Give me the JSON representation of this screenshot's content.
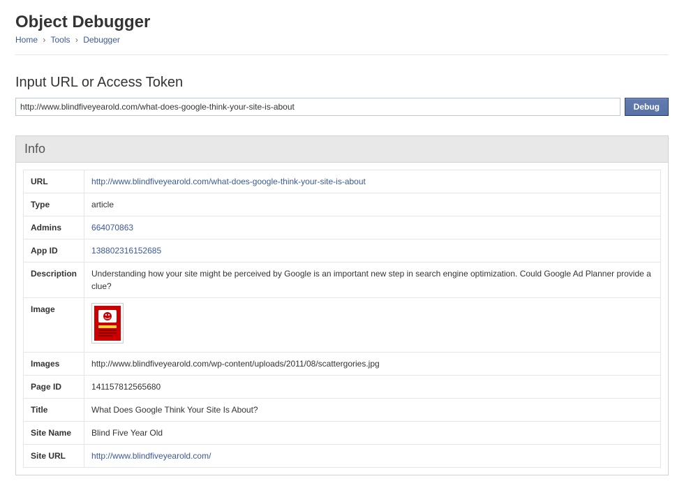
{
  "header": {
    "title": "Object Debugger"
  },
  "breadcrumb": {
    "home": "Home",
    "tools": "Tools",
    "debugger": "Debugger"
  },
  "section": {
    "input_title": "Input URL or Access Token"
  },
  "input": {
    "url_value": "http://www.blindfiveyearold.com/what-does-google-think-your-site-is-about",
    "debug_label": "Debug"
  },
  "info": {
    "panel_title": "Info",
    "labels": {
      "url": "URL",
      "type": "Type",
      "admins": "Admins",
      "app_id": "App ID",
      "description": "Description",
      "image": "Image",
      "images": "Images",
      "page_id": "Page ID",
      "title": "Title",
      "site_name": "Site Name",
      "site_url": "Site URL"
    },
    "values": {
      "url": "http://www.blindfiveyearold.com/what-does-google-think-your-site-is-about",
      "type": "article",
      "admins": "664070863",
      "app_id": "138802316152685",
      "description": "Understanding how your site might be perceived by Google is an important new step in search engine optimization. Could Google Ad Planner provide a clue?",
      "images": "http://www.blindfiveyearold.com/wp-content/uploads/2011/08/scattergories.jpg",
      "page_id": "141157812565680",
      "title": "What Does Google Think Your Site Is About?",
      "site_name": "Blind Five Year Old",
      "site_url": "http://www.blindfiveyearold.com/"
    }
  }
}
